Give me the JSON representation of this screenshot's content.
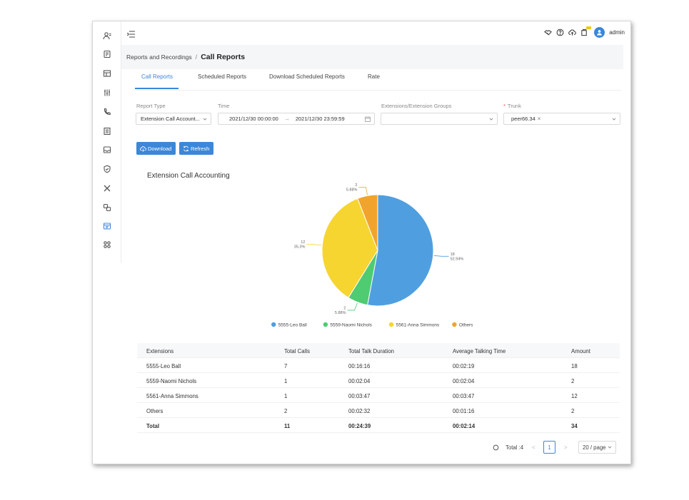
{
  "header": {
    "username": "admin"
  },
  "breadcrumb": {
    "parent": "Reports and Recordings",
    "separator": "/",
    "current": "Call Reports"
  },
  "tabs": [
    {
      "label": "Call Reports",
      "active": true
    },
    {
      "label": "Scheduled Reports",
      "active": false
    },
    {
      "label": "Download Scheduled Reports",
      "active": false
    },
    {
      "label": "Rate",
      "active": false
    }
  ],
  "filters": {
    "report_type_label": "Report Type",
    "report_type_value": "Extension Call Account...",
    "time_label": "Time",
    "time_start": "2021/12/30 00:00:00",
    "time_arrow": "→",
    "time_end": "2021/12/30 23:59:59",
    "ext_groups_label": "Extensions/Extension Groups",
    "ext_groups_value": "",
    "trunk_required": "*",
    "trunk_label": "Trunk",
    "trunk_tag": "peer66.34",
    "trunk_tag_remove": "×"
  },
  "actions": {
    "download_label": "Download",
    "refresh_label": "Refresh"
  },
  "chart_data": {
    "type": "pie",
    "title": "Extension Call Accounting",
    "categories": [
      "5555-Leo Ball",
      "5559-Naomi Nichols",
      "5561-Anna Simmons",
      "Others"
    ],
    "values": [
      18,
      2,
      12,
      2
    ],
    "slice_labels": [
      {
        "value": "18",
        "percent": "52.94%"
      },
      {
        "value": "2",
        "percent": "5.88%"
      },
      {
        "value": "12",
        "percent": "35.3%"
      },
      {
        "value": "2",
        "percent": "5.88%"
      }
    ],
    "colors": [
      "#4f9fe0",
      "#4fcb72",
      "#f6d531",
      "#f0a42e"
    ],
    "legend_position": "bottom"
  },
  "table": {
    "columns": [
      "Extensions",
      "Total Calls",
      "Total Talk Duration",
      "Average Talking Time",
      "Amount"
    ],
    "rows": [
      [
        "5555-Leo Ball",
        "7",
        "00:16:16",
        "00:02:19",
        "18"
      ],
      [
        "5559-Naomi Nichols",
        "1",
        "00:02:04",
        "00:02:04",
        "2"
      ],
      [
        "5561-Anna Simmons",
        "1",
        "00:03:47",
        "00:03:47",
        "12"
      ],
      [
        "Others",
        "2",
        "00:02:32",
        "00:01:16",
        "2"
      ]
    ],
    "total": [
      "Total",
      "11",
      "00:24:39",
      "00:02:14",
      "34"
    ]
  },
  "pagination": {
    "total_text": "Total :4",
    "prev": "<",
    "page": "1",
    "next": ">",
    "page_size": "20 / page"
  },
  "colors": {
    "accent": "#3b87d9"
  }
}
